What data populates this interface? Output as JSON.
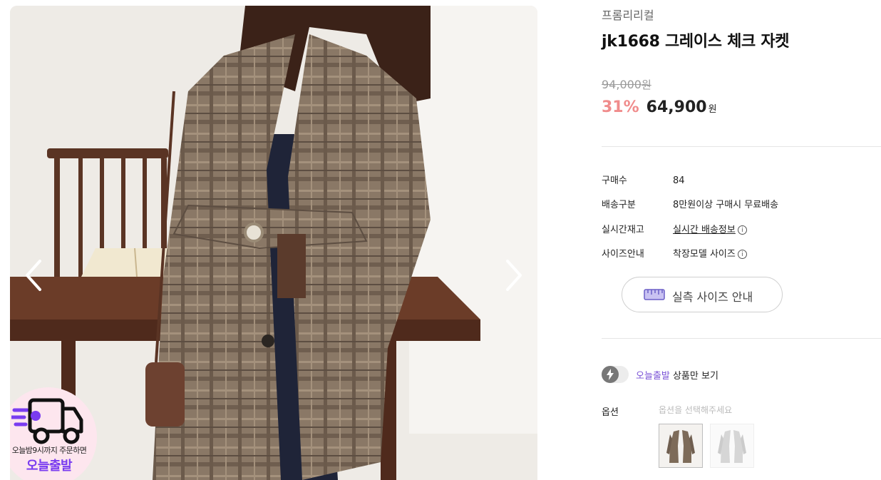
{
  "gallery": {
    "badge": {
      "line1": "오늘밤9시까지 주문하면",
      "line2": "오늘출발"
    }
  },
  "product": {
    "brand": "프롬리리컬",
    "title": "jk1668 그레이스 체크 자켓",
    "original_price": "94,000",
    "original_unit": "원",
    "discount_rate": "31%",
    "sale_price": "64,900",
    "sale_unit": "원"
  },
  "details": [
    {
      "label": "구매수",
      "value": "84"
    },
    {
      "label": "배송구분",
      "value": "8만원이상 구매시 무료배송"
    },
    {
      "label": "실시간재고",
      "value": "실시간 배송정보"
    },
    {
      "label": "사이즈안내",
      "value": "착장모델 사이즈"
    }
  ],
  "info_icon_glyph": "i",
  "size_button": {
    "label": "실측 사이즈 안내"
  },
  "today_filter": {
    "accent": "오늘출발",
    "text": " 상품만 보기"
  },
  "option": {
    "label": "옵션",
    "placeholder": "옵션을 선택해주세요"
  },
  "colors": {
    "accent": "#7a52d6",
    "discount": "#f08c8c",
    "badge_text": "#7a3cf0"
  },
  "icons": [
    "chevron-left-icon",
    "chevron-right-icon",
    "delivery-truck-icon",
    "ruler-icon",
    "info-icon",
    "lightning-icon"
  ]
}
